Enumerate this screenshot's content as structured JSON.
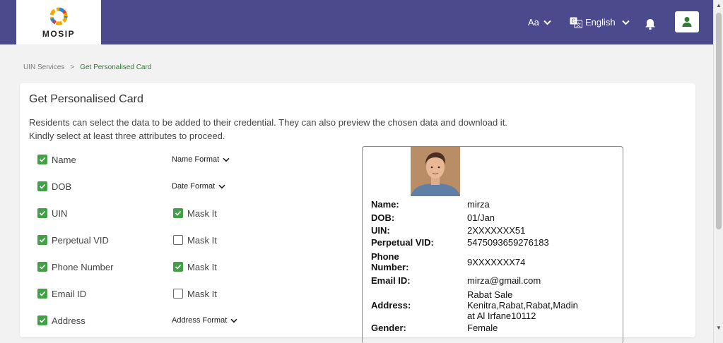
{
  "header": {
    "logo_text": "MOSIP",
    "font_size_label": "Aa",
    "language": "English"
  },
  "breadcrumb": {
    "parent": "UIN Services",
    "separator": ">",
    "current": "Get Personalised Card"
  },
  "card": {
    "title": "Get Personalised Card",
    "desc_line1": "Residents can select the data to be added to their credential. They can also preview the chosen data and download it.",
    "desc_line2": "Kindly select at least three attributes to proceed."
  },
  "attributes": [
    {
      "label": "Name",
      "checked": true,
      "option": "Name Format",
      "option_type": "format"
    },
    {
      "label": "DOB",
      "checked": true,
      "option": "Date Format",
      "option_type": "format"
    },
    {
      "label": "UIN",
      "checked": true,
      "option": "Mask It",
      "option_type": "mask",
      "mask_checked": true
    },
    {
      "label": "Perpetual VID",
      "checked": true,
      "option": "Mask It",
      "option_type": "mask",
      "mask_checked": false
    },
    {
      "label": "Phone Number",
      "checked": true,
      "option": "Mask It",
      "option_type": "mask",
      "mask_checked": true
    },
    {
      "label": "Email ID",
      "checked": true,
      "option": "Mask It",
      "option_type": "mask",
      "mask_checked": false
    },
    {
      "label": "Address",
      "checked": true,
      "option": "Address Format",
      "option_type": "format"
    }
  ],
  "preview": {
    "rows": [
      {
        "label": "Name:",
        "value": "mirza"
      },
      {
        "label": "DOB:",
        "value": "01/Jan"
      },
      {
        "label": "UIN:",
        "value": "2XXXXXXX51"
      },
      {
        "label": "Perpetual VID:",
        "value": "5475093659276183"
      },
      {
        "label": "Phone\nNumber:",
        "value": "9XXXXXXX74"
      },
      {
        "label": "Email ID:",
        "value": "mirza@gmail.com"
      },
      {
        "label": "Address:",
        "value": "Rabat Sale\nKenitra,Rabat,Rabat,Madin\nat Al Irfane10112"
      },
      {
        "label": "Gender:",
        "value": "Female"
      }
    ]
  },
  "colors": {
    "header_bg": "#4a4a8c",
    "accent_green": "#43a047",
    "breadcrumb_active": "#2e7d32"
  }
}
